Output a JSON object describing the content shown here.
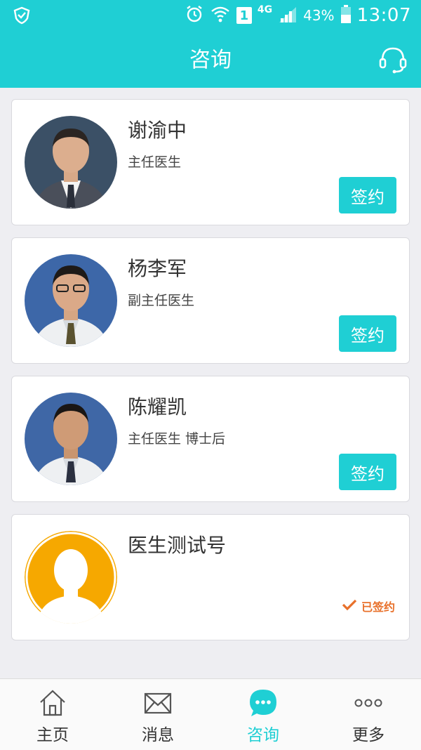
{
  "status_bar": {
    "network": "4G",
    "sim": "1",
    "battery": "43%",
    "time": "13:07"
  },
  "header": {
    "title": "咨询"
  },
  "doctors": [
    {
      "name": "谢渝中",
      "title": "主任医生",
      "action": "签约",
      "avatar": "doctor-photo",
      "bg": "#3b5066",
      "coat": "#4a4f5a"
    },
    {
      "name": "杨李军",
      "title": "副主任医生",
      "action": "签约",
      "avatar": "doctor-photo",
      "bg": "#3d67a8",
      "coat": "#eef0f2"
    },
    {
      "name": "陈耀凯",
      "title": "主任医生 博士后",
      "action": "签约",
      "avatar": "doctor-photo",
      "bg": "#3f67a6",
      "coat": "#eef0f2"
    },
    {
      "name": "医生测试号",
      "title": "",
      "status": "已签约",
      "avatar": "default-avatar",
      "bg": "#f6a800"
    }
  ],
  "tabs": [
    {
      "label": "主页",
      "icon": "home-icon",
      "active": false
    },
    {
      "label": "消息",
      "icon": "mail-icon",
      "active": false
    },
    {
      "label": "咨询",
      "icon": "chat-bubble-icon",
      "active": true
    },
    {
      "label": "更多",
      "icon": "more-icon",
      "active": false
    }
  ],
  "colors": {
    "accent": "#1fcfd4",
    "signed": "#e8702a",
    "background": "#eeeef2"
  }
}
